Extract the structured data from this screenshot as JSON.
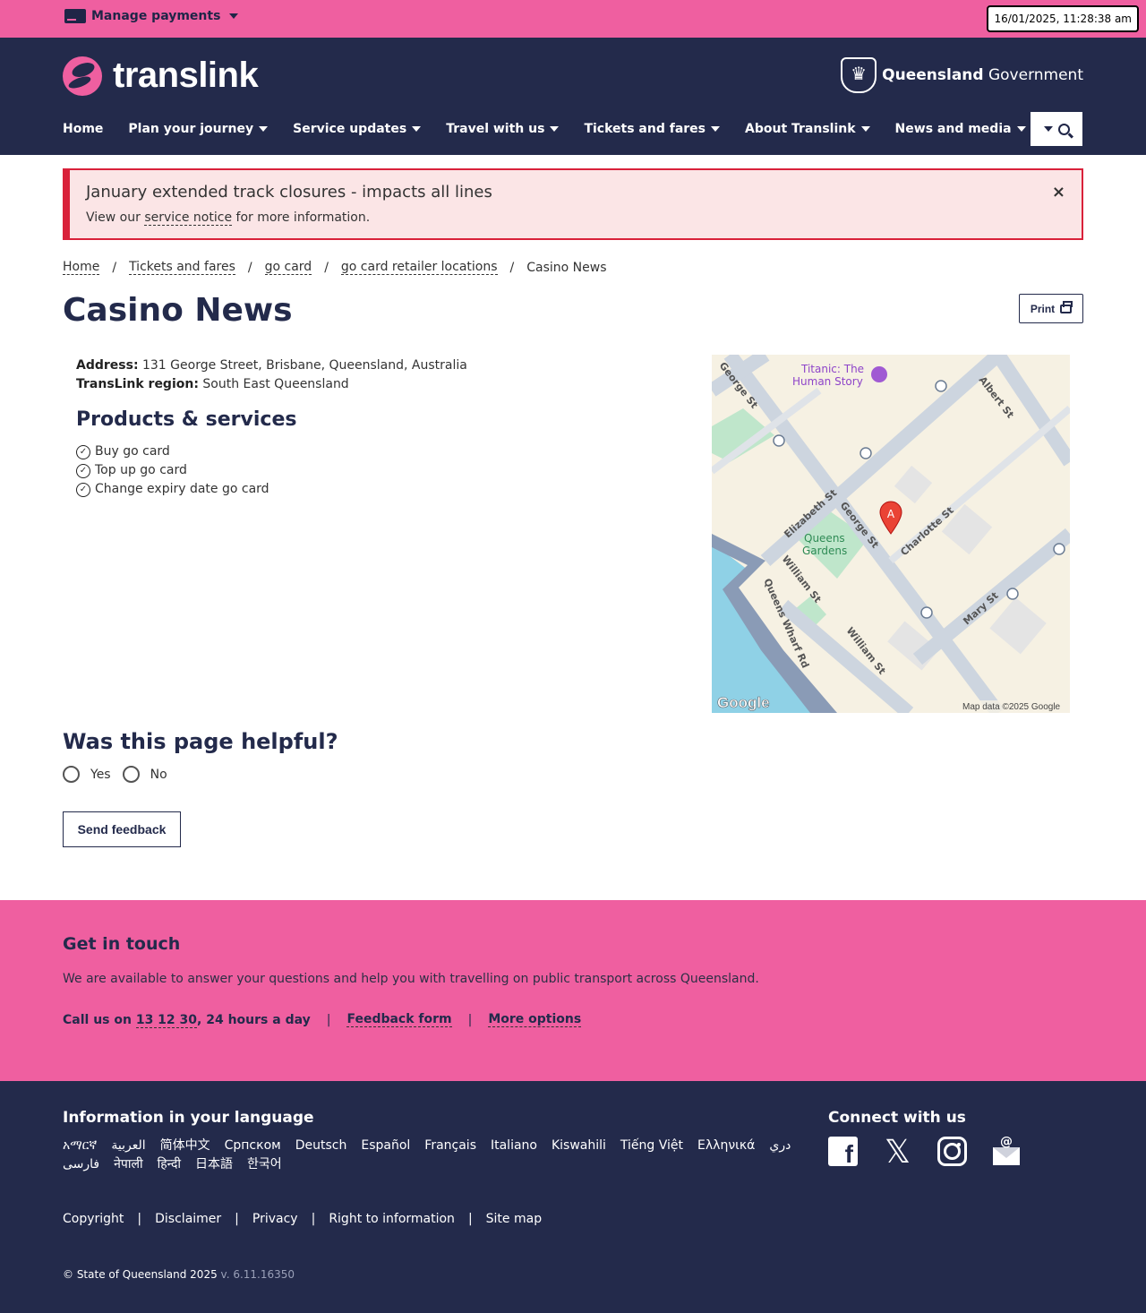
{
  "utility": {
    "manage_payments": "Manage payments",
    "datetime": "16/01/2025, 11:28:38 am"
  },
  "header": {
    "logo_text": "translink",
    "gov_bold": "Queensland",
    "gov_rest": " Government",
    "nav": [
      {
        "label": "Home",
        "has_menu": false
      },
      {
        "label": "Plan your journey",
        "has_menu": true
      },
      {
        "label": "Service updates",
        "has_menu": true
      },
      {
        "label": "Travel with us",
        "has_menu": true
      },
      {
        "label": "Tickets and fares",
        "has_menu": true
      },
      {
        "label": "About Translink",
        "has_menu": true
      },
      {
        "label": "News and media",
        "has_menu": true
      }
    ]
  },
  "alert": {
    "title": "January extended track closures - impacts all lines",
    "text_before": "View our ",
    "link": "service notice",
    "text_after": " for more information.",
    "close": "×"
  },
  "breadcrumb": {
    "items": [
      "Home",
      "Tickets and fares",
      "go card",
      "go card retailer locations"
    ],
    "current": "Casino News",
    "separator": "/"
  },
  "page": {
    "title": "Casino News",
    "print_label": "Print"
  },
  "details": {
    "address_label": "Address:",
    "address": " 131 George Street, Brisbane, Queensland, Australia",
    "region_label": "TransLink region:",
    "region": " South East Queensland"
  },
  "products": {
    "title": "Products & services",
    "items": [
      "Buy go card",
      "Top up go card",
      "Change expiry date go card"
    ]
  },
  "map": {
    "poi": [
      "Titanic: The",
      "Human Story"
    ],
    "park": [
      "Queens",
      "Gardens"
    ],
    "streets": [
      "George St",
      "Albert St",
      "Elizabeth St",
      "George St",
      "Charlotte St",
      "William St",
      "Queens Wharf Rd",
      "William St",
      "Mary St"
    ],
    "marker": "A",
    "google": "Google",
    "attribution": "Map data ©2025 Google"
  },
  "feedback": {
    "title": "Was this page helpful?",
    "yes": "Yes",
    "no": "No",
    "send": "Send feedback"
  },
  "touch": {
    "title": "Get in touch",
    "text": "We are available to answer your questions and help you with travelling on public transport across Queensland.",
    "call_prefix": "Call us on ",
    "phone": "13 12 30",
    "call_suffix": ", 24 hours a day",
    "feedback_form": "Feedback form",
    "more_options": "More options",
    "pipe": "|"
  },
  "footer": {
    "lang_title": "Information in your language",
    "languages": [
      "አማርኛ",
      "العربية",
      "简体中文",
      "Српском",
      "Deutsch",
      "Español",
      "Français",
      "Italiano",
      "Kiswahili",
      "Tiếng Việt",
      "Ελληνικά",
      "دري",
      "فارسی",
      "नेपाली",
      "हिन्दी",
      "日本語",
      "한국어"
    ],
    "connect_title": "Connect with us",
    "social_icons": [
      "facebook-icon",
      "x-icon",
      "instagram-icon",
      "email-icon"
    ],
    "legal": [
      "Copyright",
      "Disclaimer",
      "Privacy",
      "Right to information",
      "Site map"
    ],
    "copyright": "© State of Queensland 2025",
    "version": " v. 6.11.16350"
  },
  "colors": {
    "pink": "#ef5fa0",
    "navy": "#232a4b",
    "alert_red": "#d9213a",
    "alert_bg": "#fbe5e6"
  }
}
